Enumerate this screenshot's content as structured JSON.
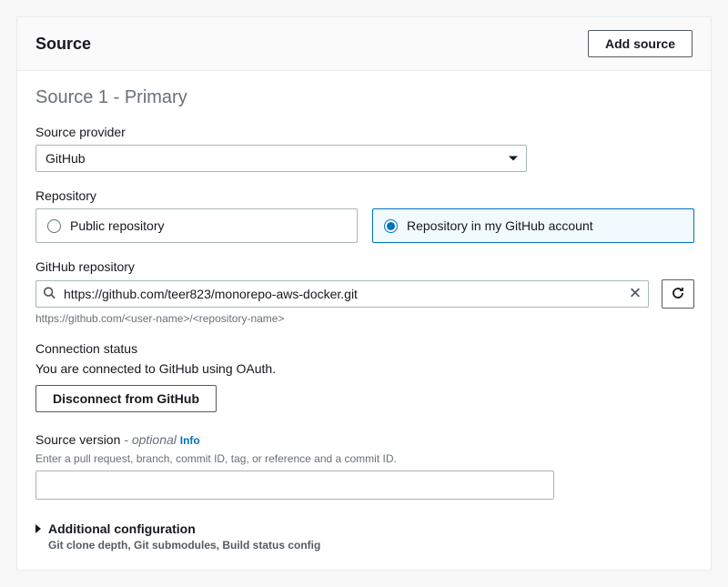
{
  "panel": {
    "title": "Source",
    "add_button": "Add source"
  },
  "section": {
    "heading": "Source 1 - Primary"
  },
  "provider": {
    "label": "Source provider",
    "value": "GitHub"
  },
  "repository": {
    "label": "Repository",
    "options": {
      "public": "Public repository",
      "account": "Repository in my GitHub account"
    }
  },
  "github_repo": {
    "label": "GitHub repository",
    "value": "https://github.com/teer823/monorepo-aws-docker.git",
    "helper": "https://github.com/<user-name>/<repository-name>"
  },
  "connection": {
    "label": "Connection status",
    "status": "You are connected to GitHub using OAuth.",
    "disconnect": "Disconnect from GitHub"
  },
  "version": {
    "label_main": "Source version",
    "label_optional": " - optional",
    "info": "Info",
    "helper": "Enter a pull request, branch, commit ID, tag, or reference and a commit ID."
  },
  "additional": {
    "title": "Additional configuration",
    "sub": "Git clone depth, Git submodules, Build status config"
  }
}
